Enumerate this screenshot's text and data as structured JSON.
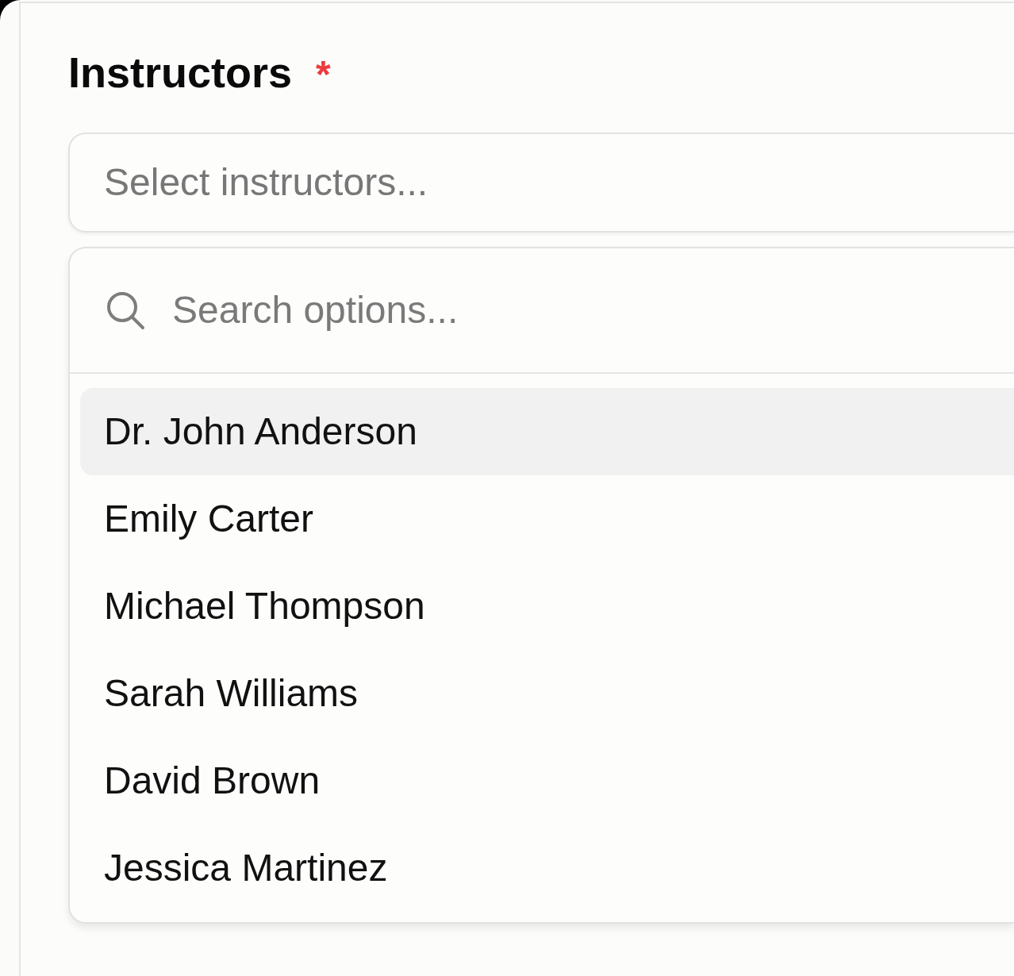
{
  "field": {
    "label": "Instructors",
    "required_mark": "*",
    "placeholder": "Select instructors..."
  },
  "dropdown": {
    "search": {
      "placeholder": "Search options..."
    },
    "options": [
      {
        "label": "Dr. John Anderson",
        "highlighted": true
      },
      {
        "label": "Emily Carter",
        "highlighted": false
      },
      {
        "label": "Michael Thompson",
        "highlighted": false
      },
      {
        "label": "Sarah Williams",
        "highlighted": false
      },
      {
        "label": "David Brown",
        "highlighted": false
      },
      {
        "label": "Jessica Martinez",
        "highlighted": false
      }
    ]
  }
}
